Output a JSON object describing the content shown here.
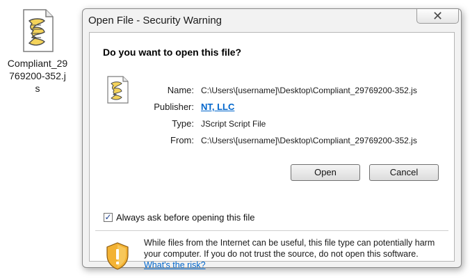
{
  "desktop": {
    "file_caption": "Compliant_29769200-352.js",
    "file_icon": "script-file-icon"
  },
  "dialog": {
    "title": "Open File - Security Warning",
    "close_label": "✕",
    "heading": "Do you want to open this file?",
    "file_icon": "script-file-icon",
    "fields": {
      "name_label": "Name:",
      "name_value": "C:\\Users\\[username]\\Desktop\\Compliant_29769200-352.js",
      "publisher_label": "Publisher:",
      "publisher_value": "NT, LLC",
      "type_label": "Type:",
      "type_value": "JScript Script File",
      "from_label": "From:",
      "from_value": "C:\\Users\\[username]\\Desktop\\Compliant_29769200-352.js"
    },
    "buttons": {
      "open_label": "Open",
      "cancel_label": "Cancel"
    },
    "checkbox": {
      "label": "Always ask before opening this file",
      "checked": true
    },
    "warning": {
      "text": "While files from the Internet can be useful, this file type can potentially harm your computer. If you do not trust the source, do not open this software.",
      "link_label": "What's the risk?",
      "icon": "security-shield-icon"
    }
  }
}
